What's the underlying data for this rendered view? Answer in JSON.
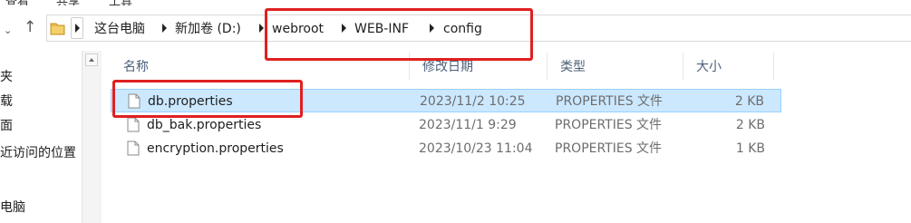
{
  "menu": {
    "items": [
      "查看",
      "共享",
      "工具"
    ]
  },
  "nav": {
    "up_arrow": "↑",
    "recent_arrow": "⌄"
  },
  "address": {
    "crumbs": [
      "这台电脑",
      "新加卷 (D:)",
      "webroot",
      "WEB-INF",
      "config"
    ]
  },
  "sidebar": {
    "items": [
      "夹",
      "载",
      "面",
      "近访问的位置",
      "电脑"
    ]
  },
  "columns": {
    "name": "名称",
    "date": "修改日期",
    "type": "类型",
    "size": "大小"
  },
  "files": [
    {
      "name": "db.properties",
      "date": "2023/11/2 10:25",
      "type": "PROPERTIES 文件",
      "size": "2 KB",
      "selected": true
    },
    {
      "name": "db_bak.properties",
      "date": "2023/11/1 9:29",
      "type": "PROPERTIES 文件",
      "size": "2 KB",
      "selected": false
    },
    {
      "name": "encryption.properties",
      "date": "2023/10/23 11:04",
      "type": "PROPERTIES 文件",
      "size": "1 KB",
      "selected": false
    }
  ],
  "colors": {
    "selection": "#cce8ff",
    "selection_border": "#99d1ff",
    "annotation": "#e02020",
    "header_text": "#4c607a"
  },
  "icons": {
    "folder": "folder-icon",
    "file": "file-icon",
    "up": "up-arrow-icon"
  }
}
